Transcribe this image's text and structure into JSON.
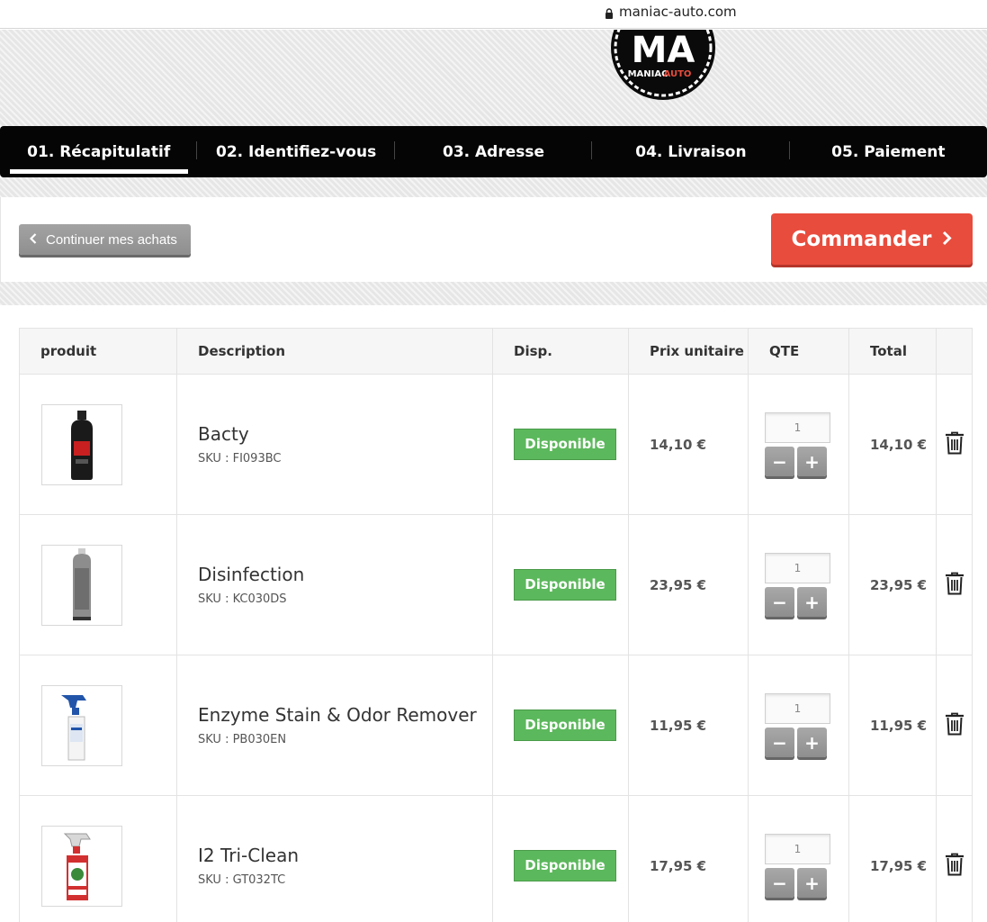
{
  "browser": {
    "url": "maniac-auto.com",
    "lock_icon": "lock-icon"
  },
  "brand": {
    "logo_monogram": "MA",
    "logo_text_1": "MANIAC",
    "logo_text_2": "AUTO",
    "accent": "#e84c3d"
  },
  "steps": [
    {
      "label": "01. Récapitulatif",
      "active": true
    },
    {
      "label": "02. Identifiez-vous",
      "active": false
    },
    {
      "label": "03. Adresse",
      "active": false
    },
    {
      "label": "04. Livraison",
      "active": false
    },
    {
      "label": "05. Paiement",
      "active": false
    }
  ],
  "actions": {
    "continue_label": "Continuer mes achats",
    "order_label": "Commander"
  },
  "table": {
    "headers": [
      "produit",
      "Description",
      "Disp.",
      "Prix unitaire",
      "QTE",
      "Total"
    ],
    "rows": [
      {
        "name": "Bacty",
        "sku": "SKU : FI093BC",
        "availability": "Disponible",
        "unit_price": "14,10 €",
        "qty": "1",
        "total": "14,10 €"
      },
      {
        "name": "Disinfection",
        "sku": "SKU : KC030DS",
        "availability": "Disponible",
        "unit_price": "23,95 €",
        "qty": "1",
        "total": "23,95 €"
      },
      {
        "name": "Enzyme Stain & Odor Remover",
        "sku": "SKU : PB030EN",
        "availability": "Disponible",
        "unit_price": "11,95 €",
        "qty": "1",
        "total": "11,95 €"
      },
      {
        "name": "I2 Tri-Clean",
        "sku": "SKU : GT032TC",
        "availability": "Disponible",
        "unit_price": "17,95 €",
        "qty": "1",
        "total": "17,95 €"
      }
    ],
    "qty_minus": "−",
    "qty_plus": "+"
  }
}
